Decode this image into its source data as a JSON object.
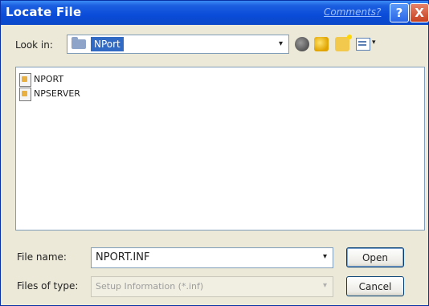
{
  "window": {
    "title": "Locate File",
    "comments_link": "Comments?",
    "help_label": "?",
    "close_label": "X"
  },
  "lookin": {
    "label": "Look in:",
    "value": "NPort",
    "arrow": "▾"
  },
  "toolbar": {
    "icons": [
      "back-icon",
      "up-folder-icon",
      "new-folder-icon",
      "views-icon"
    ],
    "views_caret": "▾"
  },
  "files": [
    {
      "name": "NPORT",
      "icon": "setup-info-file-icon"
    },
    {
      "name": "NPSERVER",
      "icon": "setup-info-file-icon"
    }
  ],
  "form": {
    "filename_label": "File name:",
    "filename_value": "NPORT.INF",
    "filename_arrow": "▾",
    "filetype_label": "Files of type:",
    "filetype_value": "Setup Information (*.inf)",
    "filetype_arrow": "▾"
  },
  "buttons": {
    "open": "Open",
    "cancel": "Cancel"
  },
  "colors": {
    "titlebar": "#0a4bd8",
    "dialog_bg": "#ece9d8",
    "selection": "#316ac5"
  }
}
